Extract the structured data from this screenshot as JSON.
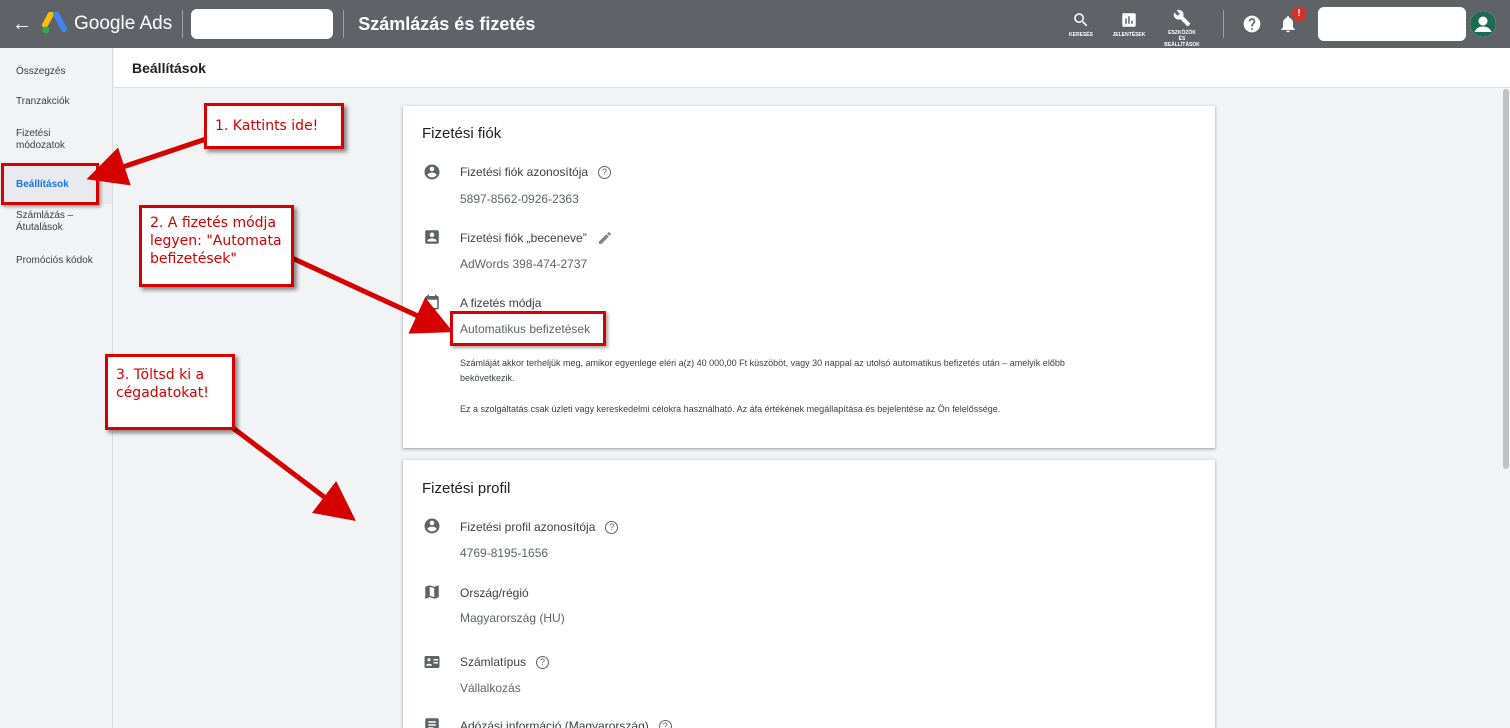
{
  "topbar": {
    "back_icon": "arrow-left-icon",
    "logo_text": "Google Ads",
    "page_title": "Számlázás és fizetés",
    "tools": {
      "search_label": "KERESÉS",
      "reports_label": "JELENTÉSEK",
      "tools_label_1": "ESZKÖZÖK",
      "tools_label_2": "ÉS",
      "tools_label_3": "BEÁLLÍTÁSOK"
    },
    "notification_badge": "!"
  },
  "sidebar": {
    "items": [
      {
        "label": "Összegzés"
      },
      {
        "label": "Tranzakciók"
      },
      {
        "label": "Fizetési módozatok"
      },
      {
        "label": "Beállítások"
      },
      {
        "label": "Számlázás – Átutalások"
      },
      {
        "label": "Promóciós kódok"
      }
    ]
  },
  "subheader": {
    "title": "Beállítások"
  },
  "payment_account": {
    "title": "Fizetési fiók",
    "id_label": "Fizetési fiók azonosítója",
    "id_value": "5897-8562-0926-2363",
    "nickname_label": "Fizetési fiók „beceneve”",
    "nickname_value": "AdWords 398-474-2737",
    "method_label": "A fizetés módja",
    "method_value": "Automatikus befizetések",
    "method_desc_1": "Számláját akkor terheljük meg, amikor egyenlege eléri a(z) 40 000,00 Ft küszöböt, vagy 30 nappal az utolsó automatikus befizetés után – amelyik előbb",
    "method_desc_2": "bekövetkezik.",
    "notice": "Ez a szolgáltatás csak üzleti vagy kereskedelmi célokra használható. Az áfa értékének megállapítása és bejelentése az Ön felelőssége."
  },
  "payment_profile": {
    "title": "Fizetési profil",
    "id_label": "Fizetési profil azonosítója",
    "id_value": "4769-8195-1656",
    "country_label": "Ország/régió",
    "country_value": "Magyarország (HU)",
    "type_label": "Számlatípus",
    "type_value": "Vállalkozás",
    "tax_label": "Adózási információ (Magyarország)"
  },
  "annotations": {
    "step1": "1. Kattints ide!",
    "step2_line1": "2. A fizetés módja",
    "step2_line2": "legyen: \"Automata",
    "step2_line3": "befizetések\"",
    "step3_line1": "3. Töltsd ki a",
    "step3_line2": "cégadatokat!"
  },
  "colors": {
    "topbar": "#5f6368",
    "accent": "#1a73e8",
    "annotation_red": "#d50000"
  }
}
